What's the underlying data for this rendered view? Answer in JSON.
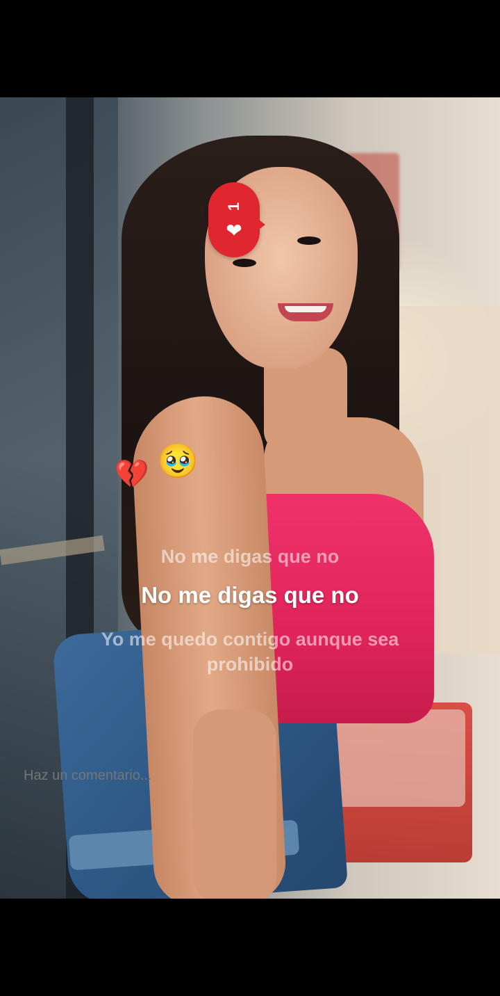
{
  "reaction": {
    "count": "1",
    "heart_icon": "heart-icon",
    "color": "#e0262e"
  },
  "emojis": {
    "broken_heart": "💔",
    "pleading_face": "🥹"
  },
  "lyrics": {
    "previous": "No me digas que no",
    "current": "No me digas que no",
    "next": "Yo me quedo contigo aunque sea prohibido"
  },
  "comment": {
    "placeholder": "Haz un comentario..."
  }
}
